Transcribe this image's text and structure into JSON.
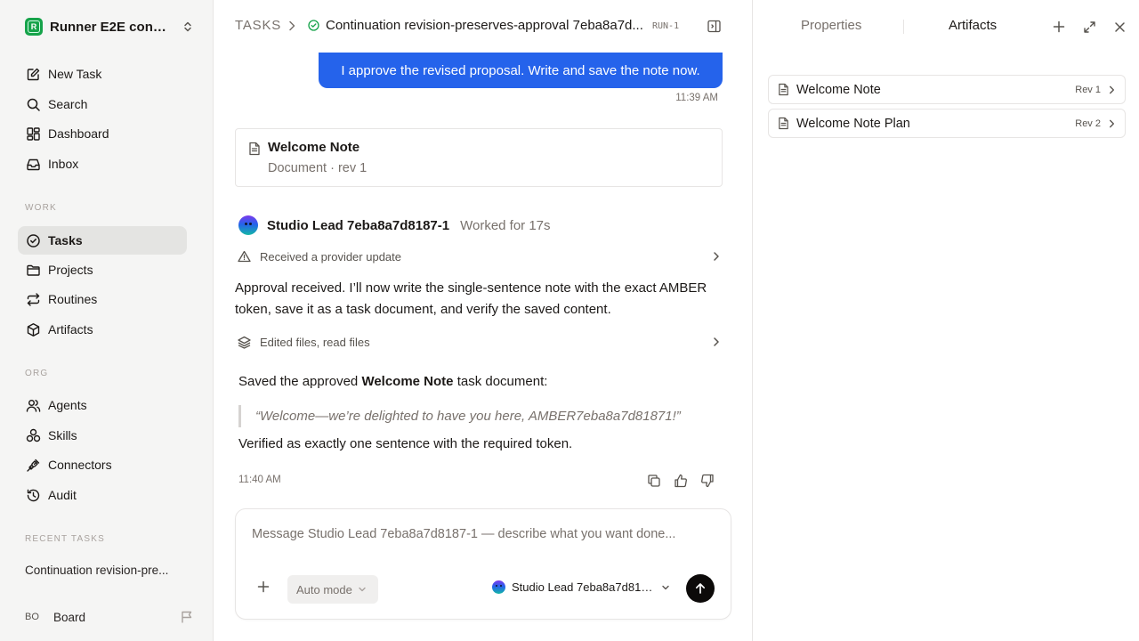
{
  "sidebar": {
    "workspace": "Runner E2E conti...",
    "workspace_initial": "R",
    "nav": {
      "new_task": "New Task",
      "search": "Search",
      "dashboard": "Dashboard",
      "inbox": "Inbox"
    },
    "work_label": "WORK",
    "work": {
      "tasks": "Tasks",
      "projects": "Projects",
      "routines": "Routines",
      "artifacts": "Artifacts"
    },
    "org_label": "ORG",
    "org": {
      "agents": "Agents",
      "skills": "Skills",
      "connectors": "Connectors",
      "audit": "Audit"
    },
    "recent_label": "RECENT TASKS",
    "recent_task": "Continuation revision-pre...",
    "user_initials": "BO",
    "user_name": "Board"
  },
  "header": {
    "crumb": "TASKS",
    "title": "Continuation revision-preserves-approval 7eba8a7d...",
    "run_badge": "RUN-1"
  },
  "chat": {
    "user_message": "I approve the revised proposal. Write and save the note now.",
    "user_time": "11:39 AM",
    "doc_card": {
      "title": "Welcome Note",
      "subtitle": "Document · rev 1"
    },
    "agent_name": "Studio Lead 7eba8a7d8187-1",
    "worked_for": "Worked for 17s",
    "activity_1": "Received a provider update",
    "paragraph": "Approval received. I’ll now write the single-sentence note with the exact AMBER token, save it as a task document, and verify the saved content.",
    "activity_2": "Edited files, read files",
    "saved_pre": "Saved the approved ",
    "saved_bold": "Welcome Note",
    "saved_post": " task document:",
    "quote": "“Welcome—we’re delighted to have you here, AMBER7eba8a7d81871!”",
    "verified": "Verified as exactly one sentence with the required token.",
    "msg_time": "11:40 AM"
  },
  "composer": {
    "placeholder": "Message Studio Lead 7eba8a7d8187-1 — describe what you want done...",
    "mode": "Auto mode",
    "agent": "Studio Lead 7eba8a7d8187-1"
  },
  "right_panel": {
    "tab_properties": "Properties",
    "tab_artifacts": "Artifacts",
    "artifacts": [
      {
        "name": "Welcome Note",
        "rev": "Rev 1"
      },
      {
        "name": "Welcome Note Plan",
        "rev": "Rev 2"
      }
    ]
  },
  "colors": {
    "accent": "#2563eb",
    "status_green": "#16a34a",
    "send_button": "#0c0a09"
  }
}
